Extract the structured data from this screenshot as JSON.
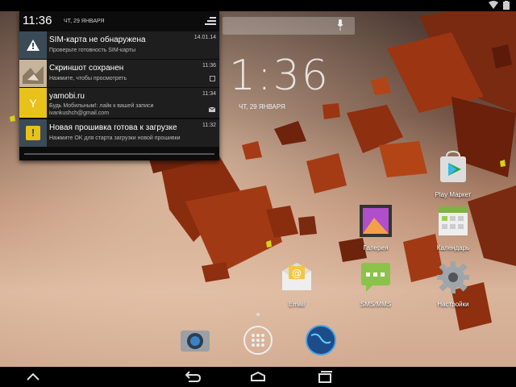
{
  "status_bar": {
    "icons": [
      "wifi-icon",
      "battery-icon"
    ]
  },
  "home_clock": {
    "time": "1:36",
    "date": "ЧТ, 29 ЯНВАРЯ"
  },
  "shade": {
    "time": "11:36",
    "date": "ЧТ, 29 ЯНВАРЯ",
    "notifications": [
      {
        "title": "SIM-карта не обнаружена",
        "text": "Проверьте готовность SIM-карты",
        "text2": "",
        "time": "14.01.14",
        "icon": "warning-icon",
        "icon_bg": "#3b4a57"
      },
      {
        "title": "Скриншот сохранен",
        "text": "Нажмите, чтобы просмотреть",
        "text2": "",
        "time": "11:36",
        "icon": "screenshot-thumbnail",
        "icon_bg": "#b9a58d"
      },
      {
        "title": "yamobi.ru",
        "text": "Будь Мобильным!: лайк к вашей записи",
        "text2": "ivankushch@gmail.com",
        "time": "11:34",
        "icon": "yamobi-icon",
        "icon_bg": "#e8c21a"
      },
      {
        "title": "Новая прошивка готова к загрузке",
        "text": "Нажмите OK для старта загрузки новой прошивки",
        "text2": "",
        "time": "11:32",
        "icon": "update-icon",
        "icon_bg": "#3b4a57"
      }
    ]
  },
  "apps": {
    "play_market": "Play Маркет",
    "gallery": "Галерея",
    "calendar": "Календарь",
    "email": "Email",
    "sms": "SMS/MMS",
    "settings": "Настройки"
  },
  "dock": [
    "camera-icon",
    "app-drawer-icon",
    "browser-icon"
  ],
  "navbar": [
    "hide-icon",
    "back-icon",
    "home-icon",
    "recents-icon"
  ]
}
